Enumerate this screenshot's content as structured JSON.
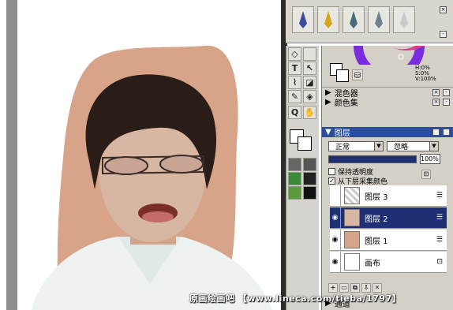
{
  "watermark": "原画绘画吧 【www.lineca.com/tieba/1797】",
  "panels": {
    "mixer": "混色器",
    "colorset": "颜色集",
    "layers": "图层"
  },
  "hsv": {
    "h": "H:0%",
    "s": "S:0%",
    "v": "V:100%"
  },
  "blend": {
    "mode": "正常",
    "composite": "忽略",
    "opacity": "100%"
  },
  "options": {
    "preserve": "保持透明度",
    "sample": "从下层采集颜色"
  },
  "layers": [
    {
      "name": "图层 3",
      "selected": false,
      "visible": false
    },
    {
      "name": "图层 2",
      "selected": true,
      "visible": true
    },
    {
      "name": "图层 1",
      "selected": false,
      "visible": true
    },
    {
      "name": "画布",
      "selected": false,
      "visible": true
    }
  ],
  "bottom_tab": "通道",
  "colors": {
    "skin_bg": "#d7a48a",
    "hair": "#2a1c16",
    "accent": "#2b4d9e"
  }
}
